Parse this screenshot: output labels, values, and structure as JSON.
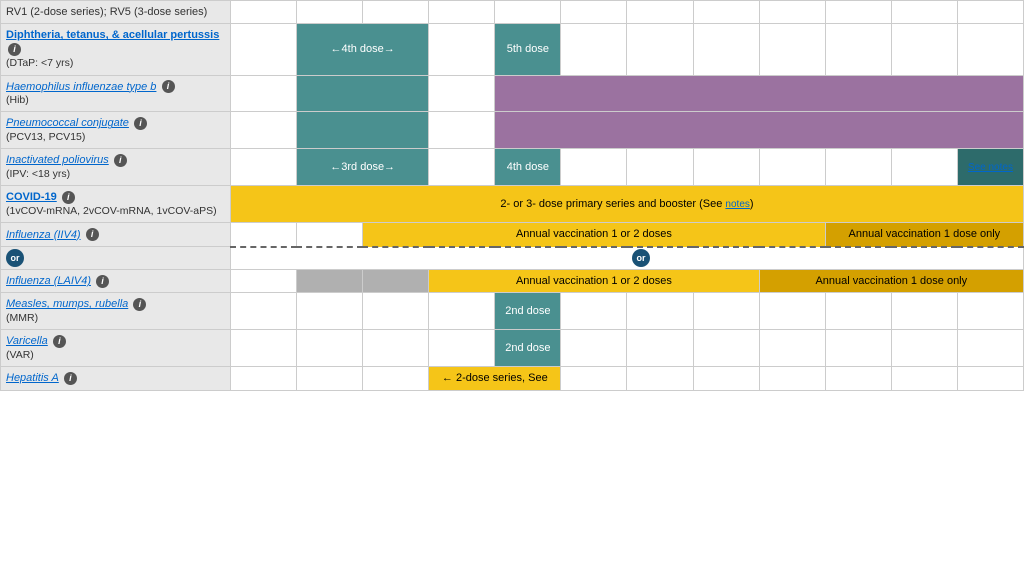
{
  "rows": [
    {
      "id": "rv",
      "name": "RV1 (2-dose series); RV5 (3-dose series)",
      "nameStyle": "text",
      "cols": [
        "empty",
        "empty",
        "empty",
        "empty",
        "empty",
        "empty",
        "empty",
        "empty",
        "empty",
        "empty",
        "empty",
        "empty"
      ]
    },
    {
      "id": "dtap",
      "name": "Diphtheria, tetanus, & acellular pertussis",
      "nameStyle": "link-bold",
      "sub": "(DTaP: <7 yrs)",
      "info": true,
      "cols": [
        "empty",
        "teal-arrow4",
        "teal",
        "empty",
        "teal-5th",
        "empty",
        "empty",
        "empty",
        "empty",
        "empty",
        "empty",
        "empty"
      ]
    },
    {
      "id": "hib",
      "name": "Haemophilus influenzae type b",
      "nameStyle": "link-italic",
      "sub": "(Hib)",
      "info": true,
      "cols": [
        "empty",
        "teal",
        "teal",
        "empty",
        "purple-span",
        "",
        "",
        "",
        "",
        "",
        "",
        ""
      ]
    },
    {
      "id": "pcv",
      "name": "Pneumococcal conjugate",
      "nameStyle": "link",
      "sub": "(PCV13, PCV15)",
      "info": true,
      "cols": [
        "empty",
        "teal",
        "teal",
        "empty",
        "purple-span",
        "",
        "",
        "",
        "",
        "",
        "",
        ""
      ]
    },
    {
      "id": "ipv",
      "name": "Inactivated poliovirus",
      "nameStyle": "link",
      "sub": "(IPV: <18 yrs)",
      "info": true,
      "cols": [
        "empty",
        "teal-arrow3",
        "teal",
        "empty",
        "teal-4th",
        "empty",
        "empty",
        "empty",
        "empty",
        "empty",
        "empty",
        "see-notes"
      ]
    },
    {
      "id": "covid",
      "name": "COVID-19",
      "nameStyle": "link-bold",
      "sub": "(1vCOV-mRNA, 2vCOV-mRNA, 1vCOV-aPS)",
      "info": true,
      "cols": [
        "covid-span"
      ]
    },
    {
      "id": "influenza-iiv4",
      "name": "Influenza (IIV4)",
      "nameStyle": "link",
      "info": true,
      "cols": [
        "empty",
        "empty",
        "yellow-annual12",
        "",
        "",
        "",
        "",
        "",
        "",
        "",
        "yellow-annual1",
        ""
      ]
    },
    {
      "id": "influenza-laiv4",
      "name": "Influenza (LAIV4)",
      "nameStyle": "link",
      "info": true,
      "cols": [
        "empty",
        "empty",
        "empty",
        "yellow-annual12-b",
        "",
        "",
        "",
        "",
        "",
        "yellow-annual1-b",
        "",
        ""
      ]
    },
    {
      "id": "mmr",
      "name": "Measles, mumps, rubella",
      "nameStyle": "link",
      "sub": "(MMR)",
      "info": true,
      "cols": [
        "empty",
        "empty",
        "empty",
        "empty",
        "teal-2nd",
        "empty",
        "empty",
        "empty",
        "empty",
        "empty",
        "empty",
        "empty"
      ]
    },
    {
      "id": "varicella",
      "name": "Varicella",
      "nameStyle": "link",
      "sub": "(VAR)",
      "info": true,
      "cols": [
        "empty",
        "empty",
        "empty",
        "empty",
        "teal-2nd",
        "empty",
        "empty",
        "empty",
        "empty",
        "empty",
        "empty",
        "empty"
      ]
    },
    {
      "id": "hep-a",
      "name": "Hepatitis A",
      "nameStyle": "link",
      "info": true,
      "cols": [
        "empty",
        "empty",
        "empty",
        "yellow-2dose",
        "",
        "empty",
        "empty",
        "empty",
        "empty",
        "empty",
        "empty",
        "empty"
      ]
    }
  ],
  "labels": {
    "dtap_dose4": "←4th dose→",
    "dtap_dose5": "5th dose",
    "ipv_dose3": "←3rd dose→",
    "ipv_dose4": "4th dose",
    "ipv_seenotes": "See notes",
    "covid_text": "2- or 3- dose primary series and booster (See notes)",
    "influenza_annual12": "Annual vaccination 1 or 2 doses",
    "influenza_annual1": "Annual vaccination 1 dose only",
    "influenza_annual12b": "Annual vaccination 1 or 2 doses",
    "influenza_annual1b": "Annual vaccination 1 dose only",
    "mmr_dose2": "2nd dose",
    "var_dose2": "2nd dose",
    "hepa_2dose": "← 2-dose series, See",
    "or_label": "or",
    "notes_link": "notes"
  }
}
